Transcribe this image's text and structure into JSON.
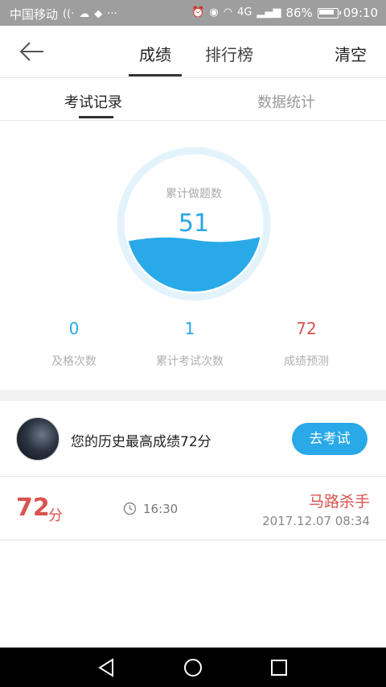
{
  "status_bar": {
    "carrier": "中国移动",
    "battery": "86%",
    "time": "09:10",
    "signal": "4G"
  },
  "header": {
    "tabs": [
      {
        "label": "成绩",
        "active": true
      },
      {
        "label": "排行榜",
        "active": false
      }
    ],
    "clear_label": "清空"
  },
  "subtabs": [
    {
      "label": "考试记录",
      "active": true
    },
    {
      "label": "数据统计",
      "active": false
    }
  ],
  "gauge": {
    "label": "累计做题数",
    "value": "51",
    "fill_fraction": 0.4,
    "color": "#29a9e8"
  },
  "stats": [
    {
      "value": "0",
      "label": "及格次数",
      "color": "#27a7e8"
    },
    {
      "value": "1",
      "label": "累计考试次数",
      "color": "#27a7e8"
    },
    {
      "value": "72",
      "label": "成绩预测",
      "color": "#d9534f"
    }
  ],
  "best": {
    "text": "您的历史最高成绩72分",
    "button_label": "去考试"
  },
  "records": [
    {
      "score": "72",
      "unit": "分",
      "time": "16:30",
      "name": "马路杀手",
      "date": "2017.12.07  08:34"
    }
  ],
  "colors": {
    "accent": "#29a9e8",
    "danger": "#d9534f"
  }
}
